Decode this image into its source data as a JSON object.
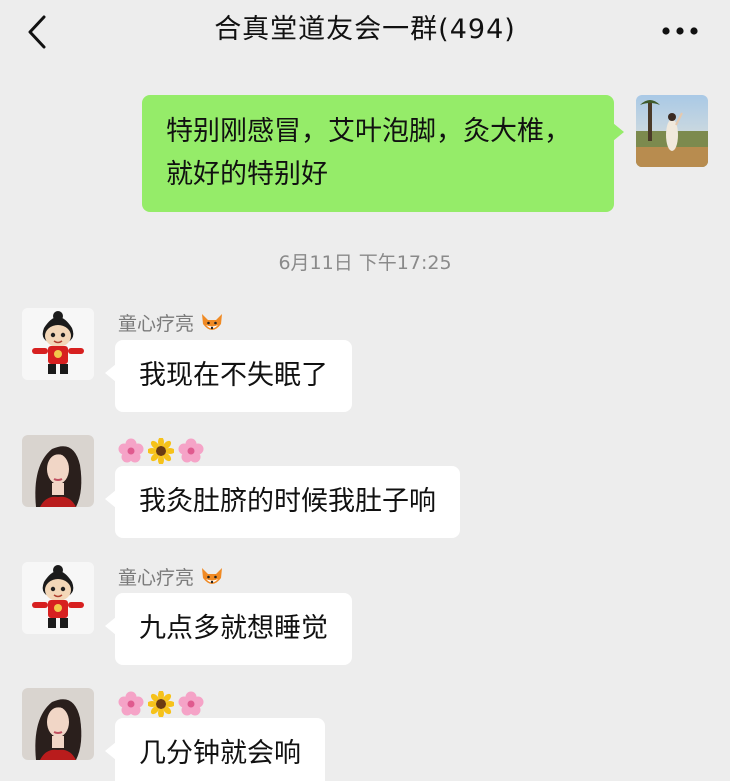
{
  "header": {
    "title": "合真堂道友会一群(494)",
    "back_icon": "chevron-left-icon",
    "more_icon": "more-dots-icon"
  },
  "messages": [
    {
      "side": "self",
      "text": "特别刚感冒，艾叶泡脚，灸大椎，就好的特别好",
      "avatar": "landscape-photo-avatar"
    },
    {
      "type": "timestamp",
      "text": "6月11日 下午17:25"
    },
    {
      "side": "other",
      "sender": "童心疗亮",
      "sender_emoji": "fox-emoji",
      "text": "我现在不失眠了",
      "avatar": "cartoon-boy-avatar"
    },
    {
      "side": "other",
      "sender_emojis": [
        "cherry-blossom-emoji",
        "sunflower-emoji",
        "cherry-blossom-emoji"
      ],
      "text": "我灸肚脐的时候我肚子响",
      "avatar": "woman-portrait-avatar"
    },
    {
      "side": "other",
      "sender": "童心疗亮",
      "sender_emoji": "fox-emoji",
      "text": "九点多就想睡觉",
      "avatar": "cartoon-boy-avatar"
    },
    {
      "side": "other",
      "sender_emojis": [
        "cherry-blossom-emoji",
        "sunflower-emoji",
        "cherry-blossom-emoji"
      ],
      "text": "几分钟就会响",
      "avatar": "woman-portrait-avatar"
    }
  ],
  "colors": {
    "background": "#ededed",
    "self_bubble": "#95ec69",
    "other_bubble": "#ffffff"
  }
}
